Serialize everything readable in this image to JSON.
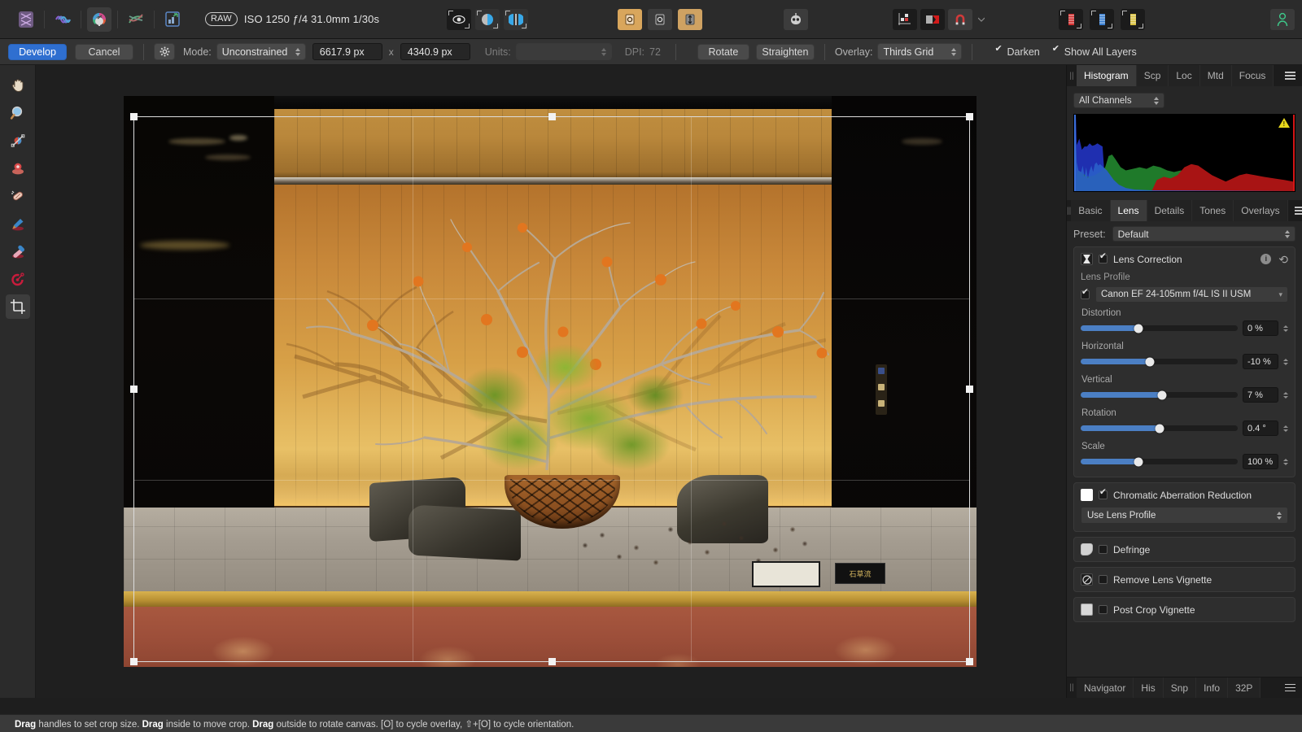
{
  "topbar": {
    "personas": [
      {
        "name": "photo-persona",
        "icon": "aperture-icon",
        "active": false
      },
      {
        "name": "liquify-persona",
        "icon": "liquify-icon",
        "active": false
      },
      {
        "name": "develop-persona",
        "icon": "develop-icon",
        "active": true
      },
      {
        "name": "tone-curve-persona",
        "icon": "tone-curve-icon",
        "active": false
      },
      {
        "name": "export-persona",
        "icon": "export-icon",
        "active": false
      }
    ],
    "raw_badge": "RAW",
    "exif": "ISO 1250 ƒ/4 31.0mm 1/30s",
    "view_buttons": [
      {
        "name": "before-after-single",
        "icon": "eye-icon",
        "active": true
      },
      {
        "name": "split-view",
        "icon": "split-circle-icon",
        "active": false
      },
      {
        "name": "mirror-view",
        "icon": "mirror-circle-icon",
        "active": false
      }
    ],
    "rotate_buttons": [
      {
        "name": "rotate-left",
        "icon": "rotate-ccw-icon"
      },
      {
        "name": "rotate-right",
        "icon": "rotate-cw-icon"
      },
      {
        "name": "flip",
        "icon": "flip-icon"
      }
    ],
    "assistant": {
      "name": "assistant-icon"
    },
    "right_group": [
      {
        "name": "layer-grid-icon",
        "active": true
      },
      {
        "name": "mask-icon",
        "active": true
      },
      {
        "name": "magnet-icon",
        "active": false
      },
      {
        "name": "chevron-down-icon",
        "active": false
      }
    ],
    "panel_toggles": [
      {
        "name": "panel-red-icon"
      },
      {
        "name": "panel-blue-icon"
      },
      {
        "name": "panel-yellow-icon"
      }
    ],
    "account": {
      "name": "account-icon"
    }
  },
  "optionsbar": {
    "develop_label": "Develop",
    "cancel_label": "Cancel",
    "gear_label": "⚙",
    "mode_label": "Mode:",
    "mode_value": "Unconstrained",
    "width_value": "6617.9 px",
    "x_label": "x",
    "height_value": "4340.9 px",
    "units_label": "Units:",
    "units_value": "",
    "dpi_label": "DPI:",
    "dpi_value": "72",
    "rotate_label": "Rotate",
    "straighten_label": "Straighten",
    "overlay_label": "Overlay:",
    "overlay_value": "Thirds Grid",
    "darken_label": "Darken",
    "darken_checked": true,
    "show_all_layers_label": "Show All Layers",
    "show_all_layers_checked": true
  },
  "lefttools": [
    {
      "name": "tool-pan",
      "icon": "hand-icon",
      "active": false
    },
    {
      "name": "tool-zoom",
      "icon": "magnifier-icon",
      "active": false
    },
    {
      "name": "tool-white-balance",
      "icon": "white-balance-icon",
      "active": false
    },
    {
      "name": "tool-blemish-removal",
      "icon": "blemish-icon",
      "active": false
    },
    {
      "name": "tool-patch",
      "icon": "patch-icon",
      "active": false
    },
    {
      "name": "tool-overlay-paint",
      "icon": "paintbrush-icon",
      "active": false
    },
    {
      "name": "tool-overlay-erase",
      "icon": "eraser-icon",
      "active": false
    },
    {
      "name": "tool-red-eye",
      "icon": "red-eye-icon",
      "active": false
    },
    {
      "name": "tool-crop",
      "icon": "crop-icon",
      "active": true
    }
  ],
  "right_top_tabs": {
    "tabs": [
      "Histogram",
      "Scp",
      "Loc",
      "Mtd",
      "Focus"
    ],
    "active": "Histogram",
    "menu_icon": "hamburger-icon"
  },
  "histogram": {
    "channel_value": "All Channels",
    "clip_warning_icon": "warning-triangle-icon"
  },
  "right_mid_tabs": {
    "tabs": [
      "Basic",
      "Lens",
      "Details",
      "Tones",
      "Overlays"
    ],
    "active": "Lens",
    "menu_icon": "hamburger-icon"
  },
  "preset": {
    "label": "Preset:",
    "value": "Default"
  },
  "lens_correction": {
    "title": "Lens Correction",
    "enabled": true,
    "thumb_icon": "lens-correction-icon",
    "info_icon": "info-icon",
    "reset_icon": "reset-icon",
    "lens_profile_label": "Lens Profile",
    "lens_profile_checked": true,
    "lens_profile_value": "Canon EF 24-105mm f/4L IS II USM",
    "sliders": [
      {
        "name": "distortion",
        "label": "Distortion",
        "value": "0 %",
        "pos": 25
      },
      {
        "name": "horizontal",
        "label": "Horizontal",
        "value": "-10 %",
        "pos": 44
      },
      {
        "name": "vertical",
        "label": "Vertical",
        "value": "7 %",
        "pos": 53
      },
      {
        "name": "rotation",
        "label": "Rotation",
        "value": "0.4 °",
        "pos": 51
      },
      {
        "name": "scale",
        "label": "Scale",
        "value": "100 %",
        "pos": 49
      }
    ]
  },
  "chromatic": {
    "title": "Chromatic Aberration Reduction",
    "enabled": true,
    "thumb_icon": "chromatic-icon",
    "mode_value": "Use Lens Profile"
  },
  "sections": [
    {
      "name": "defringe",
      "title": "Defringe",
      "enabled": false,
      "thumb_icon": "defringe-icon"
    },
    {
      "name": "remove-lens-vignette",
      "title": "Remove Lens Vignette",
      "enabled": false,
      "thumb_icon": "vignette-icon"
    },
    {
      "name": "post-crop-vignette",
      "title": "Post Crop Vignette",
      "enabled": false,
      "thumb_icon": "post-crop-vignette-icon"
    }
  ],
  "right_bottom_tabs": {
    "tabs": [
      "Navigator",
      "His",
      "Snp",
      "Info",
      "32P"
    ],
    "active": "",
    "menu_icon": "hamburger-icon"
  },
  "statusbar": {
    "parts": [
      {
        "bold": "Drag",
        "text": " handles to set crop size. "
      },
      {
        "bold": "Drag",
        "text": " inside to move crop. "
      },
      {
        "bold": "Drag",
        "text": " outside to rotate canvas. [O] to cycle overlay, ⇧+[O] to cycle orientation."
      }
    ],
    "full_text": "Drag handles to set crop size. Drag inside to move crop. Drag outside to rotate canvas. [O] to cycle overlay, ⇧+[O] to cycle orientation."
  },
  "colors": {
    "accent": "#2f6fd0",
    "slider": "#4b7fc4",
    "panel_bg": "#262626",
    "toolbar_bg": "#2b2b2b",
    "optionsbar_bg": "#333333",
    "warning": "#e8d81c"
  }
}
